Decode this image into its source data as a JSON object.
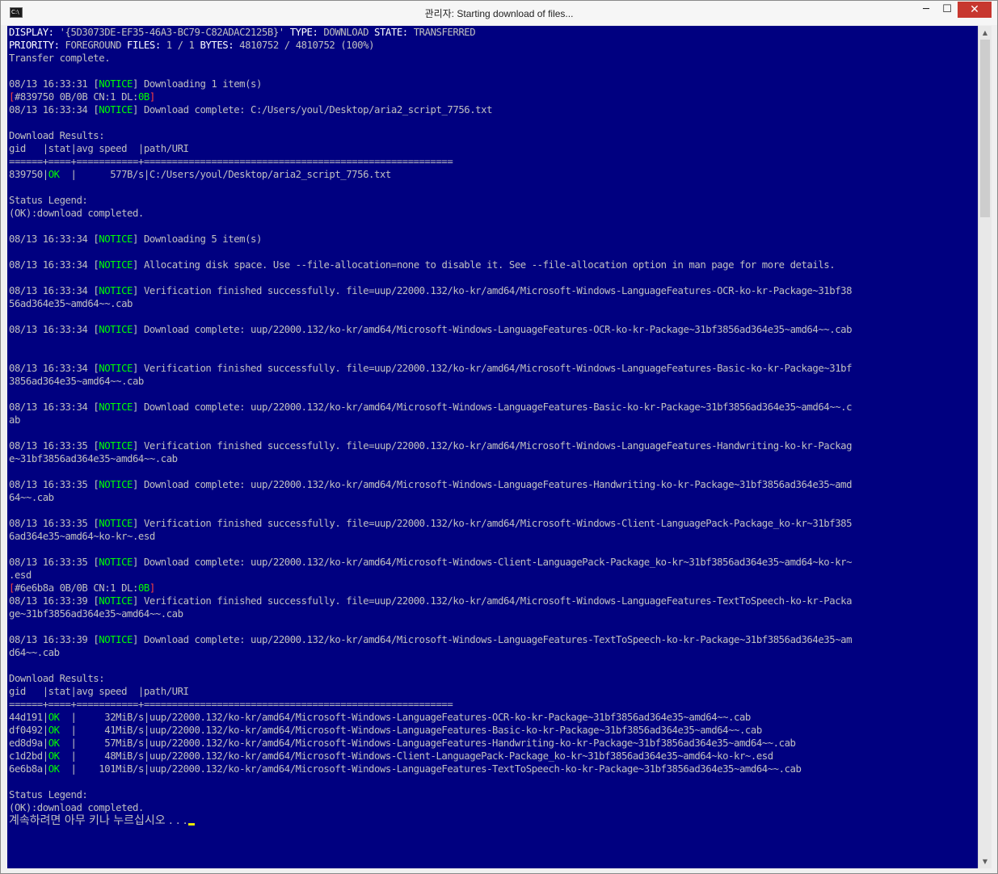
{
  "window": {
    "title": "관리자:  Starting download of files...",
    "icon_label": "C:\\",
    "controls": {
      "minimize": "─",
      "maximize": "☐",
      "close": "✕"
    }
  },
  "colors": {
    "console_bg": "#000080",
    "console_text": "#c0c0c0",
    "keyword": "#ffffff",
    "success": "#00ff00",
    "error_bracket": "#ff4040",
    "cursor": "#ffff00"
  },
  "scrollbar": {
    "up_icon": "▲",
    "down_icon": "▼"
  },
  "console": {
    "display_line": {
      "display_label": "DISPLAY:",
      "display_value": " '{5D3073DE-EF35-46A3-BC79-C82ADAC2125B}' ",
      "type_label": "TYPE:",
      "type_value": " DOWNLOAD ",
      "state_label": "STATE:",
      "state_value": " TRANSFERRED"
    },
    "priority_line": {
      "priority_label": "PRIORITY:",
      "priority_value": " FOREGROUND ",
      "files_label": "FILES:",
      "files_value": " 1 / 1 ",
      "bytes_label": "BYTES:",
      "bytes_value": " 4810752 / 4810752 (100%)"
    },
    "transfer_complete": "Transfer complete.",
    "notice_word": "NOTICE",
    "log1": {
      "time": "08/13 16:33:31 ",
      "msg": " Downloading 1 item(s)"
    },
    "progress1": {
      "text": "#839750 0B/0B CN:1 DL:",
      "dl": "0B"
    },
    "log2": {
      "time": "08/13 16:33:34 ",
      "msg": " Download complete: C:/Users/youl/Desktop/aria2_script_7756.txt"
    },
    "results1": {
      "title": "Download Results:",
      "header": "gid   |stat|avg speed  |path/URI",
      "divider": "======+====+===========+=======================================================",
      "rows": [
        {
          "gid": "839750|",
          "stat": "OK",
          "rest": "  |      577B/s|C:/Users/youl/Desktop/aria2_script_7756.txt"
        }
      ]
    },
    "legend1": {
      "title": "Status Legend:",
      "body": "(OK):download completed."
    },
    "log3": {
      "time": "08/13 16:33:34 ",
      "msg": " Downloading 5 item(s)"
    },
    "log4": {
      "time": "08/13 16:33:34 ",
      "msg": " Allocating disk space. Use --file-allocation=none to disable it. See --file-allocation option in man page for more details."
    },
    "log5": {
      "time": "08/13 16:33:34 ",
      "msg": " Verification finished successfully. file=uup/22000.132/ko-kr/amd64/Microsoft-Windows-LanguageFeatures-OCR-ko-kr-Package~31bf38",
      "cont": "56ad364e35~amd64~~.cab"
    },
    "log6": {
      "time": "08/13 16:33:34 ",
      "msg": " Download complete: uup/22000.132/ko-kr/amd64/Microsoft-Windows-LanguageFeatures-OCR-ko-kr-Package~31bf3856ad364e35~amd64~~.cab"
    },
    "log7": {
      "time": "08/13 16:33:34 ",
      "msg": " Verification finished successfully. file=uup/22000.132/ko-kr/amd64/Microsoft-Windows-LanguageFeatures-Basic-ko-kr-Package~31bf",
      "cont": "3856ad364e35~amd64~~.cab"
    },
    "log8": {
      "time": "08/13 16:33:34 ",
      "msg": " Download complete: uup/22000.132/ko-kr/amd64/Microsoft-Windows-LanguageFeatures-Basic-ko-kr-Package~31bf3856ad364e35~amd64~~.c",
      "cont": "ab"
    },
    "log9": {
      "time": "08/13 16:33:35 ",
      "msg": " Verification finished successfully. file=uup/22000.132/ko-kr/amd64/Microsoft-Windows-LanguageFeatures-Handwriting-ko-kr-Packag",
      "cont": "e~31bf3856ad364e35~amd64~~.cab"
    },
    "log10": {
      "time": "08/13 16:33:35 ",
      "msg": " Download complete: uup/22000.132/ko-kr/amd64/Microsoft-Windows-LanguageFeatures-Handwriting-ko-kr-Package~31bf3856ad364e35~amd",
      "cont": "64~~.cab"
    },
    "log11": {
      "time": "08/13 16:33:35 ",
      "msg": " Verification finished successfully. file=uup/22000.132/ko-kr/amd64/Microsoft-Windows-Client-LanguagePack-Package_ko-kr~31bf385",
      "cont": "6ad364e35~amd64~ko-kr~.esd"
    },
    "log12": {
      "time": "08/13 16:33:35 ",
      "msg": " Download complete: uup/22000.132/ko-kr/amd64/Microsoft-Windows-Client-LanguagePack-Package_ko-kr~31bf3856ad364e35~amd64~ko-kr~",
      "cont": ".esd"
    },
    "progress2": {
      "text": "#6e6b8a 0B/0B CN:1 DL:",
      "dl": "0B"
    },
    "log13": {
      "time": "08/13 16:33:39 ",
      "msg": " Verification finished successfully. file=uup/22000.132/ko-kr/amd64/Microsoft-Windows-LanguageFeatures-TextToSpeech-ko-kr-Packa",
      "cont": "ge~31bf3856ad364e35~amd64~~.cab"
    },
    "log14": {
      "time": "08/13 16:33:39 ",
      "msg": " Download complete: uup/22000.132/ko-kr/amd64/Microsoft-Windows-LanguageFeatures-TextToSpeech-ko-kr-Package~31bf3856ad364e35~am",
      "cont": "d64~~.cab"
    },
    "results2": {
      "title": "Download Results:",
      "header": "gid   |stat|avg speed  |path/URI",
      "divider": "======+====+===========+=======================================================",
      "rows": [
        {
          "gid": "44d191|",
          "stat": "OK",
          "rest": "  |     32MiB/s|uup/22000.132/ko-kr/amd64/Microsoft-Windows-LanguageFeatures-OCR-ko-kr-Package~31bf3856ad364e35~amd64~~.cab"
        },
        {
          "gid": "df0492|",
          "stat": "OK",
          "rest": "  |     41MiB/s|uup/22000.132/ko-kr/amd64/Microsoft-Windows-LanguageFeatures-Basic-ko-kr-Package~31bf3856ad364e35~amd64~~.cab"
        },
        {
          "gid": "ed8d9a|",
          "stat": "OK",
          "rest": "  |     57MiB/s|uup/22000.132/ko-kr/amd64/Microsoft-Windows-LanguageFeatures-Handwriting-ko-kr-Package~31bf3856ad364e35~amd64~~.cab"
        },
        {
          "gid": "c1d2bd|",
          "stat": "OK",
          "rest": "  |     48MiB/s|uup/22000.132/ko-kr/amd64/Microsoft-Windows-Client-LanguagePack-Package_ko-kr~31bf3856ad364e35~amd64~ko-kr~.esd"
        },
        {
          "gid": "6e6b8a|",
          "stat": "OK",
          "rest": "  |    101MiB/s|uup/22000.132/ko-kr/amd64/Microsoft-Windows-LanguageFeatures-TextToSpeech-ko-kr-Package~31bf3856ad364e35~amd64~~.cab"
        }
      ]
    },
    "legend2": {
      "title": "Status Legend:",
      "body": "(OK):download completed."
    },
    "pause_prompt": "계속하려면 아무 키나 누르십시오 . . ."
  }
}
